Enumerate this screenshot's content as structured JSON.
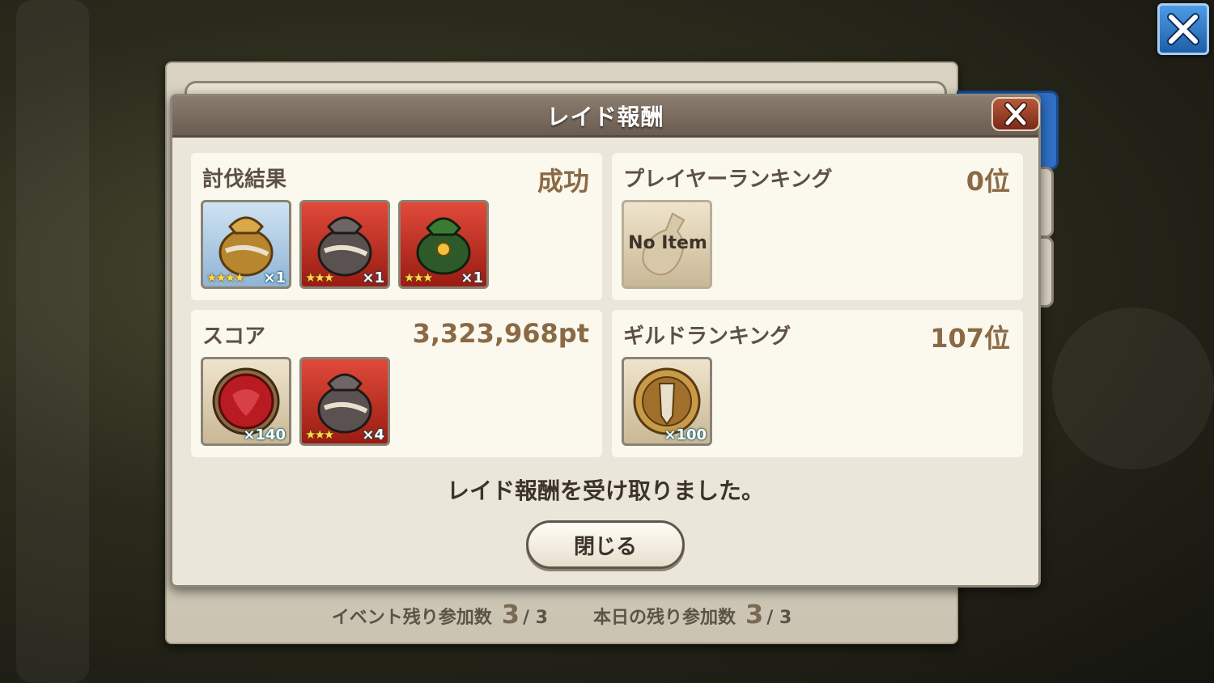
{
  "dialog": {
    "title": "レイド報酬",
    "message": "レイド報酬を受け取りました。",
    "close_button": "閉じる"
  },
  "cards": {
    "subjugation": {
      "label": "討伐結果",
      "value": "成功",
      "items": [
        {
          "icon": "gold-bag-icon",
          "stars": "★★★★",
          "qty": "×1"
        },
        {
          "icon": "silver-bag-icon",
          "stars": "★★★",
          "qty": "×1"
        },
        {
          "icon": "green-bag-icon",
          "stars": "★★★",
          "qty": "×1"
        }
      ]
    },
    "player_ranking": {
      "label": "プレイヤーランキング",
      "value": "0位",
      "no_item": "No Item"
    },
    "score": {
      "label": "スコア",
      "value": "3,323,968pt",
      "items": [
        {
          "icon": "red-gem-icon",
          "qty": "×140"
        },
        {
          "icon": "silver-bag-icon",
          "stars": "★★★",
          "qty": "×4"
        }
      ]
    },
    "guild_ranking": {
      "label": "ギルドランキング",
      "value": "107位",
      "items": [
        {
          "icon": "guild-medal-icon",
          "qty": "×100"
        }
      ]
    }
  },
  "footer": {
    "event_label": "イベント残り参加数",
    "event_remaining": "3",
    "event_total": "/ 3",
    "today_label": "本日の残り参加数",
    "today_remaining": "3",
    "today_total": "/ 3"
  },
  "colors": {
    "header": "#7a6c5f",
    "card_bg": "#fbf8ee",
    "value_text": "#8a6a44",
    "top_close": "#2f7ad0"
  }
}
